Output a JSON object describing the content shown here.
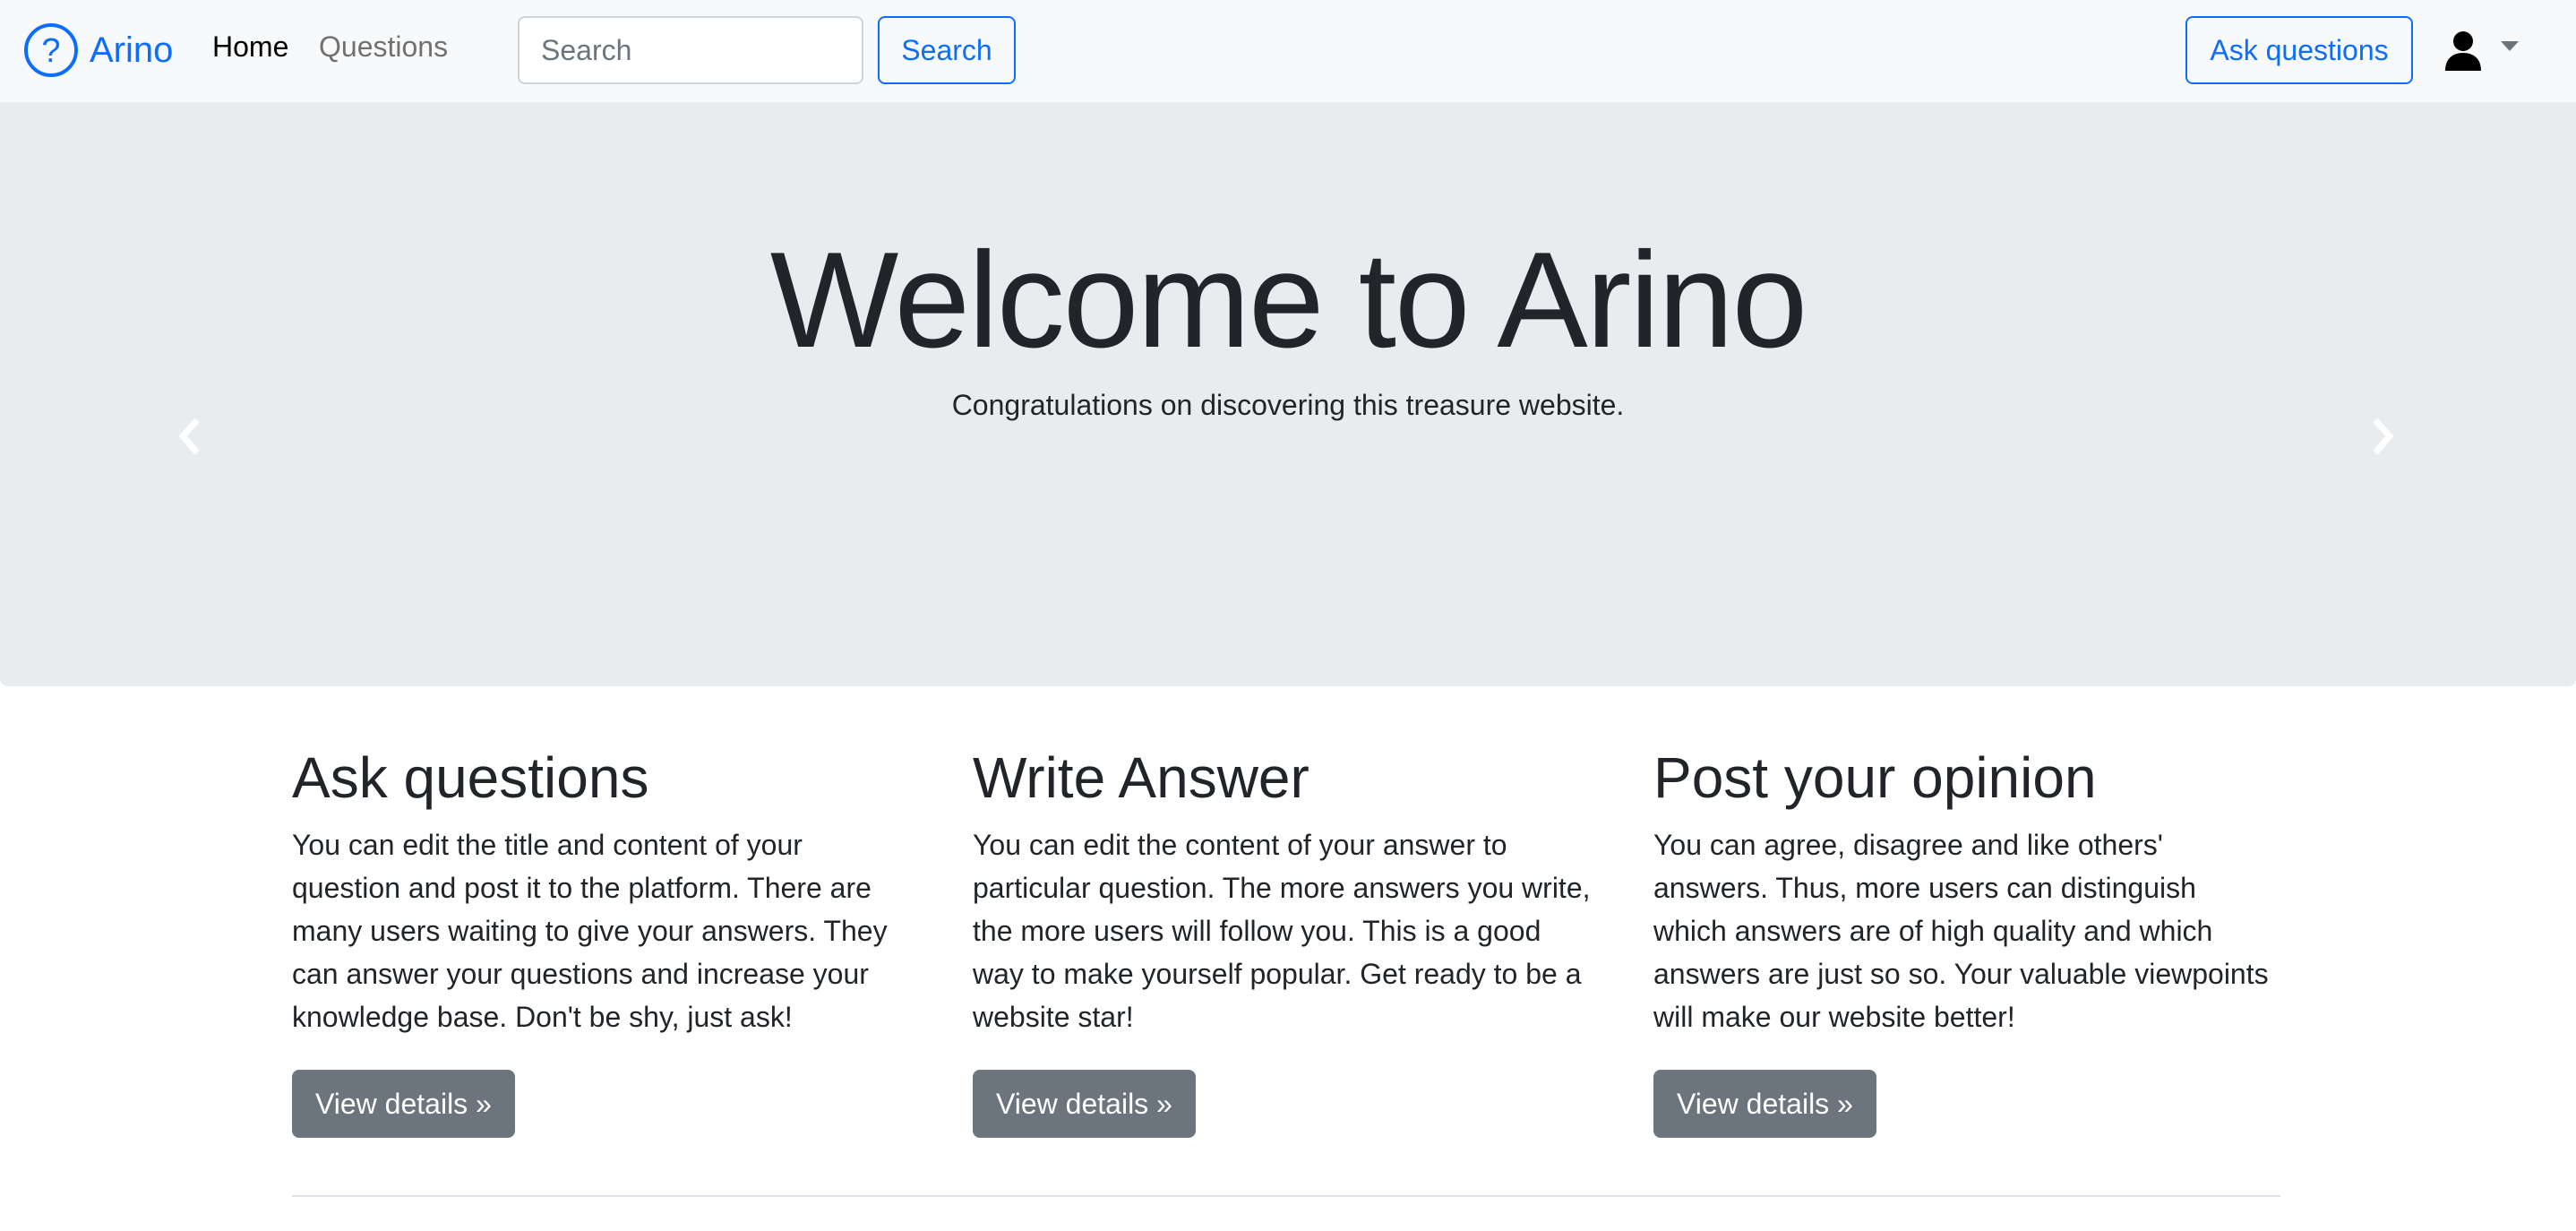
{
  "navbar": {
    "brand": "Arino",
    "links": [
      {
        "label": "Home"
      },
      {
        "label": "Questions"
      }
    ],
    "search": {
      "placeholder": "Search",
      "value": "",
      "button_label": "Search"
    },
    "ask_button_label": "Ask questions",
    "colors": {
      "brand": "#0d6efd",
      "background": "#f8f9fa"
    }
  },
  "hero": {
    "title": "Welcome to Arino",
    "subtitle": "Congratulations on discovering this treasure website.",
    "background": "#e9ecef"
  },
  "features": [
    {
      "heading": "Ask questions",
      "text": "You can edit the title and content of your question and post it to the platform. There are many users waiting to give your answers. They can answer your questions and increase your knowledge base. Don't be shy, just ask!",
      "button_label": "View details »"
    },
    {
      "heading": "Write Answer",
      "text": "You can edit the content of your answer to particular question. The more answers you write, the more users will follow you. This is a good way to make yourself popular. Get ready to be a website star!",
      "button_label": "View details »"
    },
    {
      "heading": "Post your opinion",
      "text": "You can agree, disagree and like others' answers. Thus, more users can distinguish which answers are of high quality and which answers are just so so. Your valuable viewpoints will make our website better!",
      "button_label": "View details »"
    }
  ],
  "icons": {
    "brand": "question-circle-icon",
    "user": "user-icon",
    "dropdown": "caret-down-icon",
    "prev": "chevron-left-icon",
    "next": "chevron-right-icon"
  }
}
